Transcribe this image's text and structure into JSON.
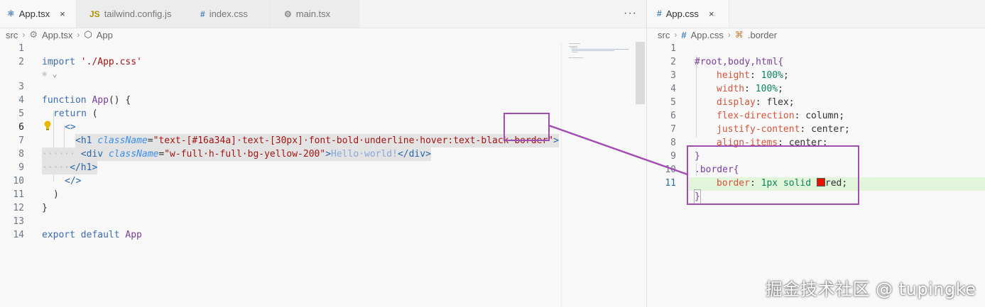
{
  "left_editor": {
    "tabs": [
      {
        "icon": "react-icon",
        "label": "App.tsx",
        "active": true
      },
      {
        "icon": "js-icon",
        "label": "tailwind.config.js",
        "active": false,
        "badge": "JS"
      },
      {
        "icon": "css-hash-icon",
        "label": "index.css",
        "active": false,
        "badge": "#"
      },
      {
        "icon": "react-icon",
        "label": "main.tsx",
        "active": false
      }
    ],
    "more_actions": "···",
    "breadcrumb": {
      "folder": "src",
      "file": "App.tsx",
      "symbol": "App"
    },
    "line_numbers": [
      "1",
      "2",
      "3",
      "4",
      "5",
      "6",
      "7",
      "8",
      "9",
      "10",
      "11",
      "12",
      "13",
      "14"
    ],
    "code": {
      "l1_kw": "import",
      "l1_str": "'./App.css'",
      "l3_kw": "function",
      "l3_fn": "App",
      "l3_rest": "() {",
      "l4_kw": "return",
      "l4_rest": " (",
      "l5": "<>",
      "l6_open": "<",
      "l6_tag": "h1",
      "l6_attr": "className",
      "l6_eq": "=",
      "l6_str": "\"text-[#16a34a]·text-[30px]·font-bold·underline·hover:text-black·border\"",
      "l6_close": ">",
      "l7_dots": "······",
      "l7_open": "<",
      "l7_tag": "div",
      "l7_attr": "className",
      "l7_str": "\"w-full·h-full·bg-yellow-200\"",
      "l7_gt": ">",
      "l7_text": "Hello·world!",
      "l7_end": "</div>",
      "l8_dots": "·····",
      "l8_end": "</h1>",
      "l9": "</>",
      "l10": ")",
      "l11": "}",
      "l13_kw": "export default",
      "l13_fn": "App"
    }
  },
  "right_editor": {
    "tab": {
      "icon": "css-hash-icon",
      "label": "App.css",
      "close": "×"
    },
    "breadcrumb": {
      "folder": "src",
      "file": "App.css",
      "symbol": ".border"
    },
    "line_numbers": [
      "1",
      "2",
      "3",
      "4",
      "5",
      "6",
      "7",
      "8",
      "9",
      "10",
      "11"
    ],
    "css": {
      "l1": "#root,body,html{",
      "rules": [
        {
          "prop": "height",
          "val": "100%"
        },
        {
          "prop": "width",
          "val": "100%"
        },
        {
          "prop": "display",
          "val": "flex"
        },
        {
          "prop": "flex-direction",
          "val": "column"
        },
        {
          "prop": "justify-content",
          "val": "center"
        },
        {
          "prop": "align-items",
          "val": "center"
        }
      ],
      "l8": "}",
      "l9": ".border{",
      "l10_prop": "border",
      "l10_val": "1px solid",
      "l10_color": "red",
      "l11": "}"
    },
    "swatch_color": "#e51400"
  },
  "annotation_color": "#a24db2",
  "watermark": "掘金技术社区 @ tupingke"
}
